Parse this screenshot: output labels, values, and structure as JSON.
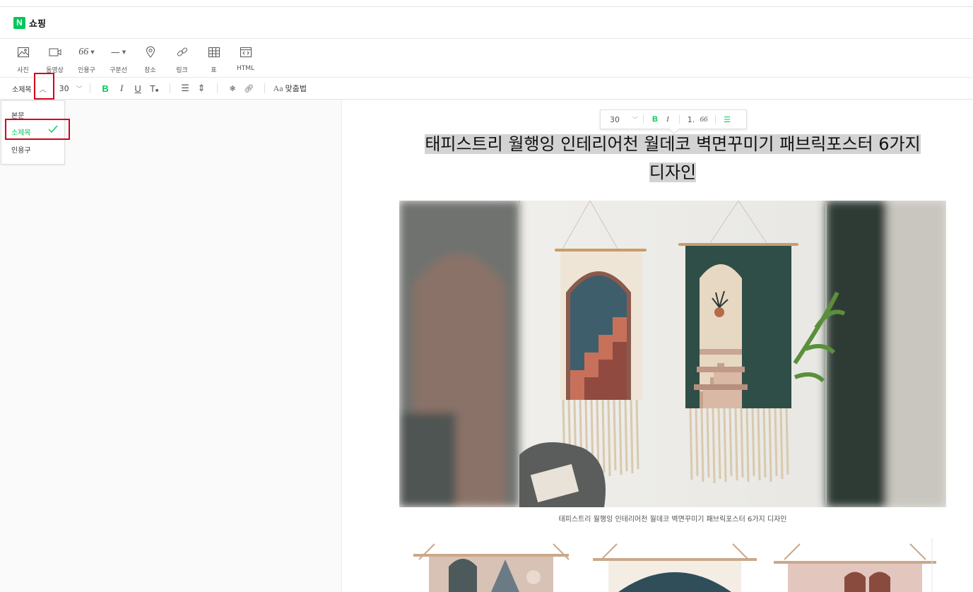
{
  "brand": {
    "logo_letter": "N",
    "name": "쇼핑"
  },
  "toolbar": {
    "items": [
      {
        "label": "사진",
        "icon": "photo-icon"
      },
      {
        "label": "동영상",
        "icon": "video-icon"
      },
      {
        "label": "인용구",
        "icon": "quote-icon",
        "glyph": "66"
      },
      {
        "label": "구분선",
        "icon": "divider-icon",
        "glyph": "—"
      },
      {
        "label": "장소",
        "icon": "place-icon"
      },
      {
        "label": "링크",
        "icon": "link-icon"
      },
      {
        "label": "표",
        "icon": "table-icon"
      },
      {
        "label": "HTML",
        "icon": "html-icon"
      }
    ]
  },
  "format": {
    "style_value": "소제목",
    "font_size": "30",
    "spell_check_label": "맞춤법",
    "spell_glyph": "Aa"
  },
  "style_dropdown": {
    "options": [
      "본문",
      "소제목",
      "인용구"
    ],
    "selected": "소제목"
  },
  "float_toolbar": {
    "size": "30",
    "bold": "B",
    "italic": "I",
    "list": "1.",
    "quote": "66"
  },
  "document": {
    "heading_line1": "태피스트리 월행잉 인테리어천 월데코 벽면꾸미기 패브릭포스터 6가지",
    "heading_line2": "디자인",
    "image_caption": "태피스트리 월행잉 인테리어천 월데코 벽면꾸미기 패브릭포스터 6가지 디자인"
  },
  "colors": {
    "accent": "#03c75a",
    "highlight_box": "#d0021b",
    "selection": "#d3d3d3"
  }
}
